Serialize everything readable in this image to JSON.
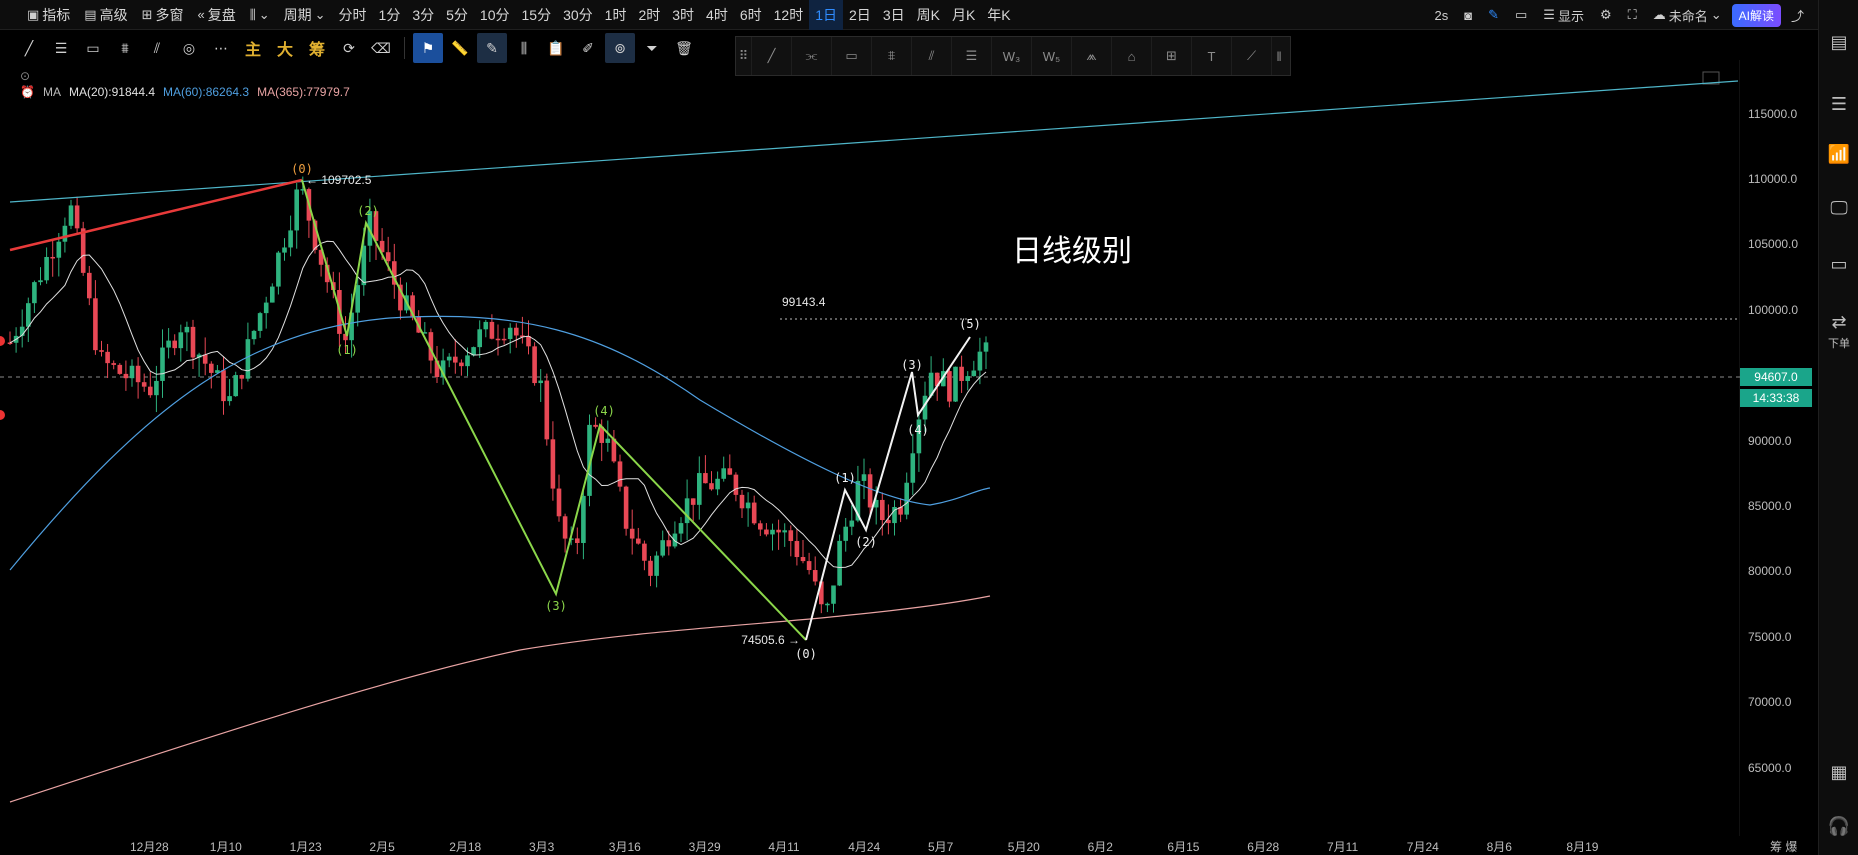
{
  "toolbar": {
    "indicators": "指标",
    "advanced": "高级",
    "multi_window": "多窗",
    "replay": "复盘",
    "period": "周期",
    "periods": [
      "分时",
      "1分",
      "3分",
      "5分",
      "10分",
      "15分",
      "30分",
      "1时",
      "2时",
      "3时",
      "4时",
      "6时",
      "12时",
      "1日",
      "2日",
      "3日",
      "周K",
      "月K",
      "年K"
    ],
    "active_period": "1日",
    "refresh": "2s",
    "display": "显示",
    "layout_name": "未命名",
    "ai": "AI解读"
  },
  "drawbar": {
    "text_tools": [
      "主",
      "大",
      "筹"
    ]
  },
  "legend": {
    "label": "MA",
    "ma20": "MA(20):91844.4",
    "ma60": "MA(60):86264.3",
    "ma365": "MA(365):77979.7",
    "colors": {
      "ma20": "#e0e0e0",
      "ma60": "#4f9fe0",
      "ma365": "#e8a3a3"
    }
  },
  "chart_title": "日线级别",
  "annotations": {
    "high_price": "109702.5",
    "low_price": "74505.6",
    "target_price": "99143.4",
    "waves_abc": [
      "(0)",
      "(1)",
      "(2)",
      "(3)",
      "(4)"
    ],
    "waves_up": [
      "(1)",
      "(2)",
      "(3)",
      "(4)",
      "(5)"
    ],
    "wave_zero": "(0)"
  },
  "price_axis": {
    "labels": [
      "115000.0",
      "110000.0",
      "105000.0",
      "100000.0",
      "95000.0",
      "90000.0",
      "85000.0",
      "80000.0",
      "75000.0",
      "70000.0",
      "65000.0"
    ],
    "current_price": "94607.0",
    "countdown": "14:33:38",
    "tag_color": "#1aa58a"
  },
  "time_axis": {
    "labels": [
      "12月28",
      "1月10",
      "1月23",
      "2月5",
      "2月18",
      "3月3",
      "3月16",
      "3月29",
      "4月11",
      "4月24",
      "5月7",
      "5月20",
      "6月2",
      "6月15",
      "6月28",
      "7月11",
      "7月24",
      "8月6",
      "8月19"
    ],
    "corner": "筹 爆"
  },
  "sidebar": {
    "sell_label": "下单"
  },
  "chart_data": {
    "type": "candlestick",
    "ylim": [
      61000,
      118500
    ],
    "indicators": [
      "MA(20)",
      "MA(60)",
      "MA(365)"
    ],
    "current_price": 94607.0,
    "high": 109702.5,
    "low": 74505.6,
    "target": 99143.4
  }
}
